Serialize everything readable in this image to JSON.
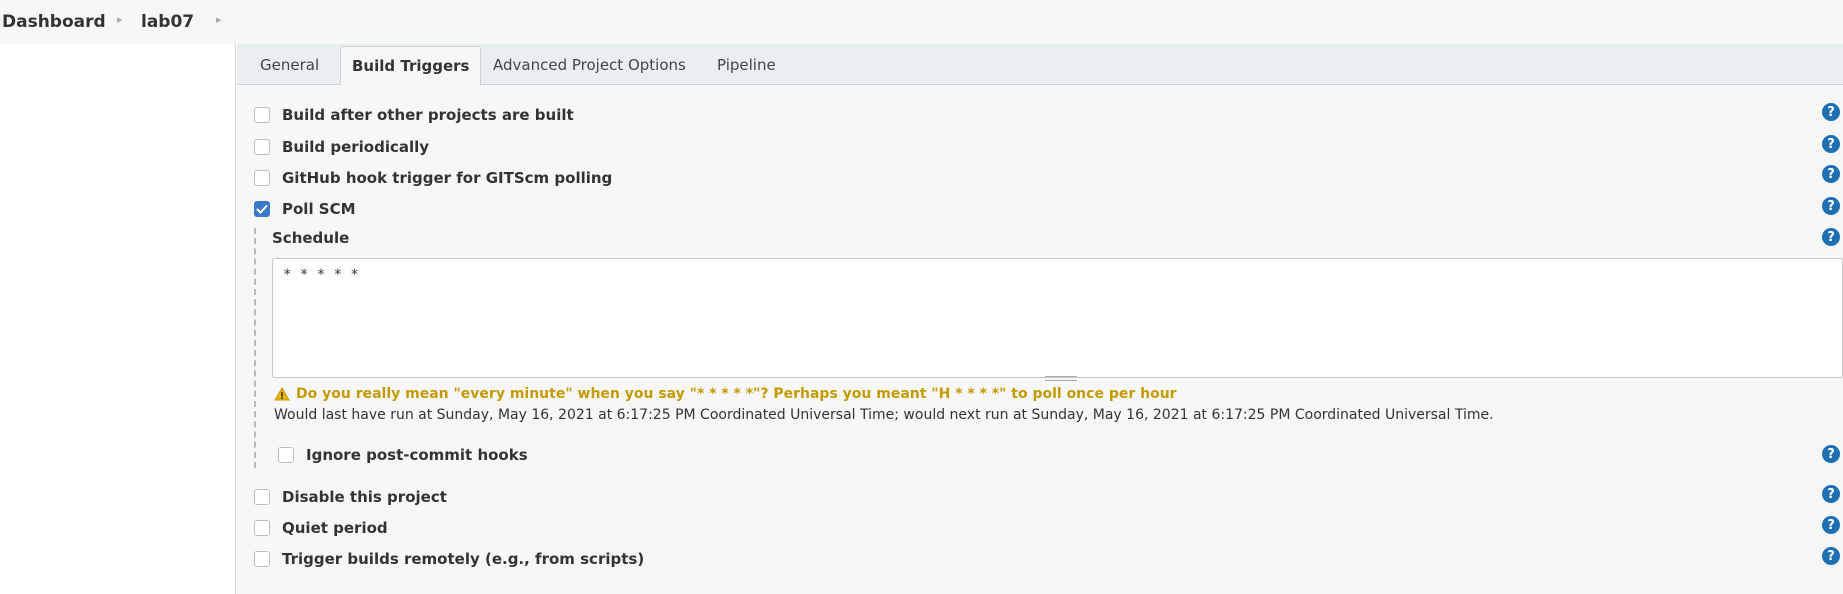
{
  "breadcrumb": {
    "items": [
      "Dashboard",
      "lab07"
    ],
    "separator": "▸"
  },
  "tabs": [
    {
      "label": "General",
      "active": false
    },
    {
      "label": "Build Triggers",
      "active": true
    },
    {
      "label": "Advanced Project Options",
      "active": false
    },
    {
      "label": "Pipeline",
      "active": false
    }
  ],
  "triggers": [
    {
      "label": "Build after other projects are built",
      "checked": false
    },
    {
      "label": "Build periodically",
      "checked": false
    },
    {
      "label": "GitHub hook trigger for GITScm polling",
      "checked": false
    },
    {
      "label": "Poll SCM",
      "checked": true
    }
  ],
  "poll_scm": {
    "schedule_label": "Schedule",
    "schedule_value": "* * * * *",
    "warning": "Do you really mean \"every minute\" when you say \"* * * * *\"? Perhaps you meant \"H * * * *\" to poll once per hour",
    "info": "Would last have run at Sunday, May 16, 2021 at 6:17:25 PM Coordinated Universal Time; would next run at Sunday, May 16, 2021 at 6:17:25 PM Coordinated Universal Time.",
    "ignore_hooks_label": "Ignore post-commit hooks",
    "ignore_hooks_checked": false
  },
  "more_triggers": [
    {
      "label": "Disable this project",
      "checked": false
    },
    {
      "label": "Quiet period",
      "checked": false
    },
    {
      "label": "Trigger builds remotely (e.g., from scripts)",
      "checked": false
    }
  ],
  "help_glyph": "?",
  "colors": {
    "accent": "#3a78c9",
    "help": "#1f6fb3",
    "warning": "#c49a00"
  }
}
